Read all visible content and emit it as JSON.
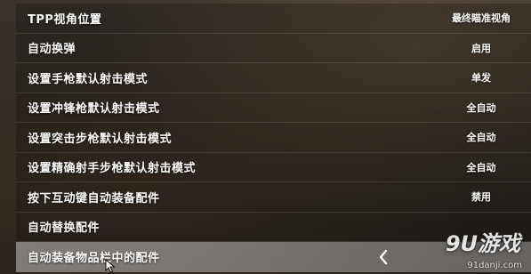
{
  "settings": [
    {
      "label": "TPP视角位置",
      "value": "最终瞄准视角"
    },
    {
      "label": "自动换弹",
      "value": "启用"
    },
    {
      "label": "设置手枪默认射击模式",
      "value": "单发"
    },
    {
      "label": "设置冲锋枪默认射击模式",
      "value": "全自动"
    },
    {
      "label": "设置突击步枪默认射击模式",
      "value": "全自动"
    },
    {
      "label": "设置精确射手步枪默认射击模式",
      "value": "全自动"
    },
    {
      "label": "按下互动键自动装备配件",
      "value": "禁用"
    },
    {
      "label": "自动替换配件",
      "value": ""
    },
    {
      "label": "自动装备物品栏中的配件",
      "value": ""
    }
  ],
  "selected_index": 8,
  "icons": {
    "collapse": "chevron-left-icon",
    "cursor": "mouse-pointer-icon"
  },
  "watermark": {
    "logo": "9U游戏",
    "url": "91danji.com"
  }
}
